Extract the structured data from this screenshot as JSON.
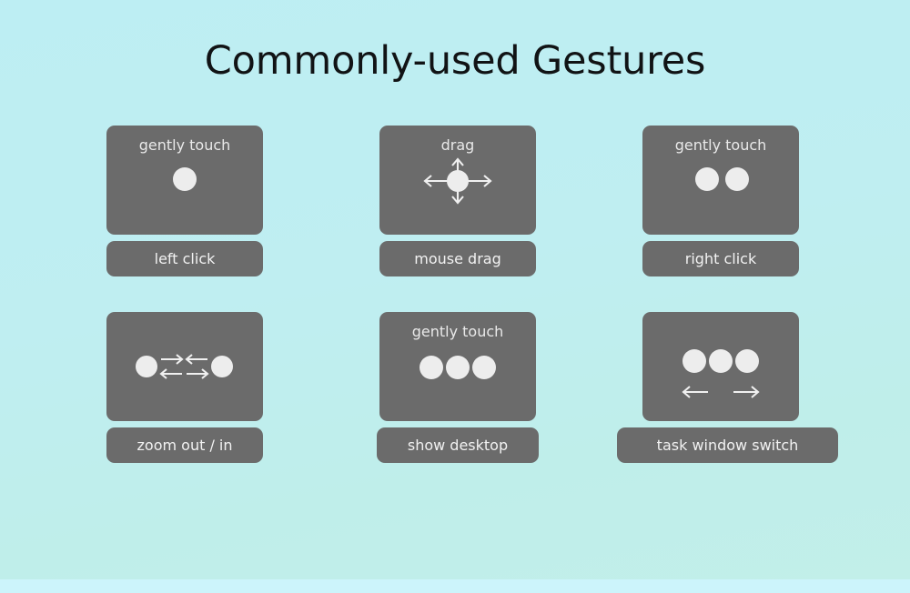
{
  "page": {
    "title": "Commonly-used Gestures",
    "background_top_color": "#bdeef3",
    "background_bottom_color": "#c2efe9",
    "card_color": "#6b6b6b",
    "dot_color": "#ededed",
    "text_color": "#f2f2f2",
    "title_color": "#111315"
  },
  "gestures": [
    {
      "id": "left-click",
      "hint": "gently touch",
      "caption": "left click",
      "finger_count": 1,
      "icon": "one-finger-tap-icon"
    },
    {
      "id": "mouse-drag",
      "hint": "drag",
      "caption": "mouse drag",
      "finger_count": 1,
      "icon": "four-way-drag-icon"
    },
    {
      "id": "right-click",
      "hint": "gently touch",
      "caption": "right click",
      "finger_count": 2,
      "icon": "two-finger-tap-icon"
    },
    {
      "id": "zoom-out-in",
      "hint": "",
      "caption": "zoom out / in",
      "finger_count": 2,
      "icon": "pinch-spread-icon"
    },
    {
      "id": "show-desktop",
      "hint": "gently touch",
      "caption": "show desktop",
      "finger_count": 3,
      "icon": "three-finger-tap-icon"
    },
    {
      "id": "task-window-switch",
      "hint": "",
      "caption": "task window switch",
      "finger_count": 3,
      "icon": "three-finger-swipe-icon"
    }
  ]
}
